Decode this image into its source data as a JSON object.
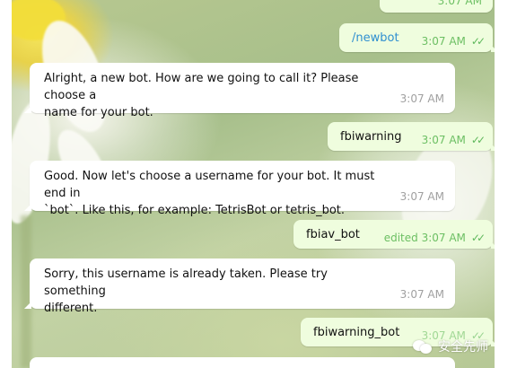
{
  "messages": [
    {
      "id": "m0",
      "dir": "out",
      "text": "",
      "time": "3:07 AM",
      "status": "read"
    },
    {
      "id": "m1",
      "dir": "out",
      "text": "/newbot",
      "time": "3:07 AM",
      "status": "read"
    },
    {
      "id": "m2",
      "dir": "in",
      "text": "Alright, a new bot. How are we going to call it? Please choose a\nname for your bot.",
      "time": "3:07 AM"
    },
    {
      "id": "m3",
      "dir": "out",
      "text": "fbiwarning",
      "time": "3:07 AM",
      "status": "read"
    },
    {
      "id": "m4",
      "dir": "in",
      "text": "Good. Now let's choose a username for your bot. It must end in\n`bot`. Like this, for example: TetrisBot or tetris_bot.",
      "time": "3:07 AM"
    },
    {
      "id": "m5",
      "dir": "out",
      "text": "fbiav_bot",
      "time": "3:07 AM",
      "edited_label": "edited",
      "status": "read"
    },
    {
      "id": "m6",
      "dir": "in",
      "text": "Sorry, this username is already taken. Please try something\ndifferent.",
      "time": "3:07 AM"
    },
    {
      "id": "m7",
      "dir": "out",
      "text": "fbiwarning_bot",
      "time": "3:07 AM",
      "status": "read"
    }
  ],
  "watermark": {
    "text": "安全先师",
    "icon": "wechat-icon"
  },
  "colors": {
    "incoming_bubble": "#ffffff",
    "outgoing_bubble": "#effdde",
    "outgoing_time": "#6cbf63",
    "incoming_time": "#a0a0a0"
  }
}
